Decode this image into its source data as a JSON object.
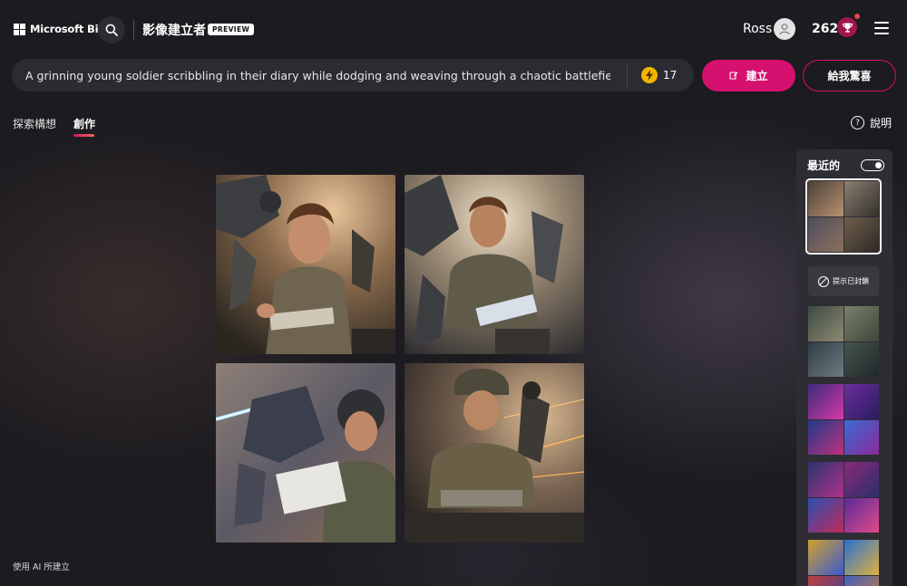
{
  "header": {
    "brand": "Microsoft Bing",
    "app_title": "影像建立者",
    "badge": "PREVIEW",
    "user_name": "Ross",
    "points": "262"
  },
  "prompt": {
    "value": "A grinning young soldier scribbling in their diary while dodging and weaving through a chaotic battlefield",
    "boosts": "17"
  },
  "actions": {
    "create_label": "建立",
    "surprise_label": "給我驚喜"
  },
  "tabs": {
    "explore": "探索構想",
    "create": "創作",
    "active": "創作"
  },
  "help_label": "說明",
  "footer_note": "使用 AI 所建立",
  "recent": {
    "title": "最近的",
    "toggle_on": true,
    "blocked_label": "提示已封鎖"
  },
  "colors": {
    "accent": "#d6106f",
    "background": "#1c1b20",
    "panel": "#2e2d33",
    "boost": "#f2b600"
  },
  "icons": [
    "windows-logo-icon",
    "search-icon",
    "user-avatar-icon",
    "trophy-icon",
    "menu-icon",
    "bolt-icon",
    "create-icon",
    "help-icon",
    "blocked-icon",
    "toggle-icon"
  ]
}
